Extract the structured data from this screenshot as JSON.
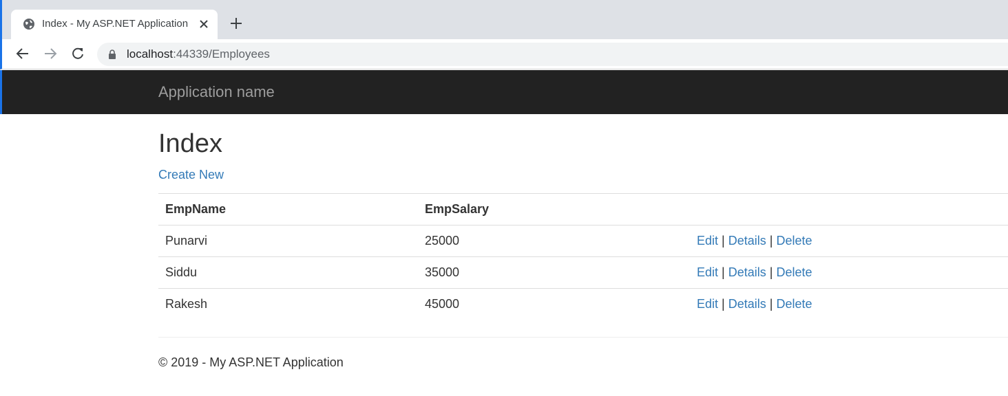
{
  "browser": {
    "tab_title": "Index - My ASP.NET Application",
    "url_host": "localhost",
    "url_rest": ":44339/Employees"
  },
  "navbar": {
    "brand": "Application name"
  },
  "main": {
    "heading": "Index",
    "create_new": "Create New",
    "table": {
      "columns": [
        "EmpName",
        "EmpSalary"
      ],
      "rows": [
        {
          "name": "Punarvi",
          "salary": "25000"
        },
        {
          "name": "Siddu",
          "salary": "35000"
        },
        {
          "name": "Rakesh",
          "salary": "45000"
        }
      ],
      "actions": {
        "edit": "Edit",
        "details": "Details",
        "delete": "Delete",
        "separator": "|"
      }
    }
  },
  "footer": {
    "text": "© 2019 - My ASP.NET Application"
  },
  "colors": {
    "navbar_bg": "#222222",
    "link": "#337ab7",
    "brand_text": "#9d9d9d"
  }
}
